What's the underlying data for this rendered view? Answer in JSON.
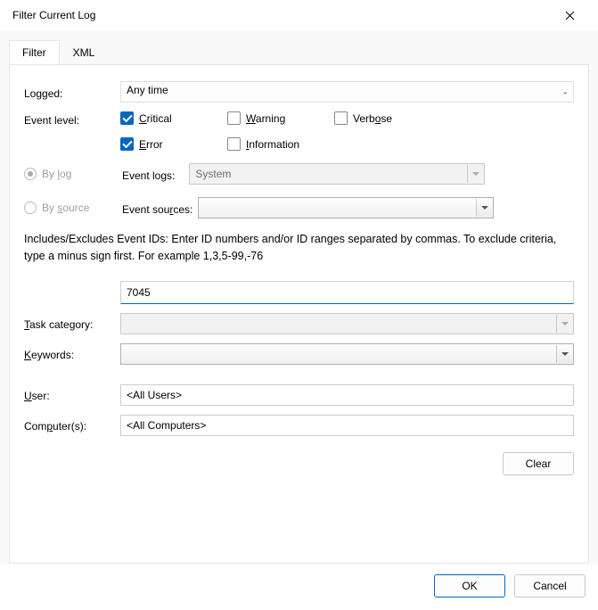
{
  "window": {
    "title": "Filter Current Log"
  },
  "tabs": {
    "filter": "Filter",
    "xml": "XML"
  },
  "labels": {
    "logged": "Logged:",
    "event_level": "Event level:",
    "by_log": "By log",
    "by_source": "By source",
    "event_logs": "Event logs:",
    "event_sources": "Event sources:",
    "task_category": "Task category:",
    "keywords": "Keywords:",
    "user": "User:",
    "computers": "Computer(s):"
  },
  "logged_value": "Any time",
  "levels": {
    "critical": {
      "label": "Critical",
      "checked": true
    },
    "warning": {
      "label": "Warning",
      "checked": false
    },
    "verbose": {
      "label": "Verbose",
      "checked": false
    },
    "error": {
      "label": "Error",
      "checked": true
    },
    "information": {
      "label": "Information",
      "checked": false
    }
  },
  "by_mode": "log",
  "event_logs_value": "System",
  "event_sources_value": "",
  "help_text": "Includes/Excludes Event IDs: Enter ID numbers and/or ID ranges separated by commas. To exclude criteria, type a minus sign first. For example 1,3,5-99,-76",
  "event_ids_value": "7045",
  "task_category_value": "",
  "keywords_value": "",
  "user_value": "<All Users>",
  "computers_value": "<All Computers>",
  "buttons": {
    "clear": "Clear",
    "ok": "OK",
    "cancel": "Cancel"
  }
}
